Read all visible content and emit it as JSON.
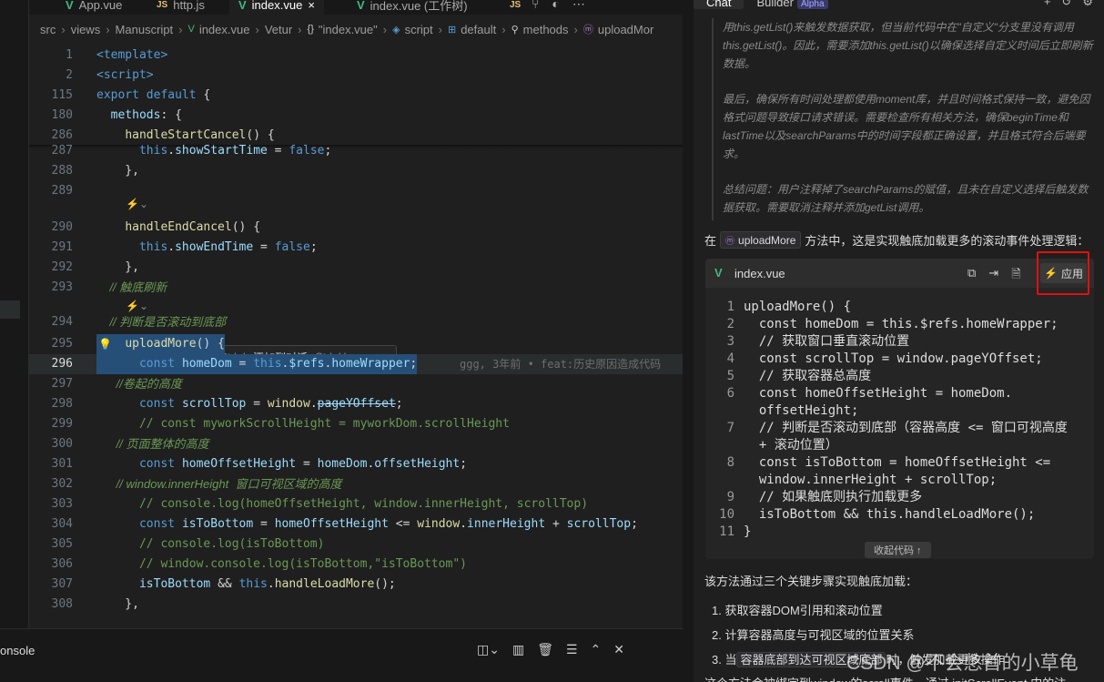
{
  "tabs": [
    {
      "name": "App.vue",
      "kind": "vue"
    },
    {
      "name": "http.js",
      "kind": "js"
    },
    {
      "name": "index.vue",
      "kind": "vue",
      "active": true
    },
    {
      "name": "index.vue (工作树)",
      "kind": "vue"
    }
  ],
  "tab_close": "×",
  "tab_extra": {
    "js_badge": "JS"
  },
  "breadcrumb": [
    "src",
    "views",
    "Manuscript",
    "index.vue",
    "Vetur",
    "\"index.vue\"",
    "script",
    "default",
    "methods",
    "uploadMor"
  ],
  "editor": {
    "lines": [
      {
        "n": "1",
        "html": [
          [
            "tag",
            "<template>"
          ]
        ]
      },
      {
        "n": "2",
        "html": [
          [
            "tag",
            "<script>"
          ]
        ]
      },
      {
        "n": "115",
        "html": [
          [
            "kw",
            "export default "
          ],
          [
            "",
            "{"
          ]
        ]
      },
      {
        "n": "180",
        "html": [
          [
            "",
            "  "
          ],
          [
            "prop",
            "methods"
          ],
          [
            "",
            ": {"
          ]
        ]
      },
      {
        "n": "286",
        "html": [
          [
            "",
            "    "
          ],
          [
            "fn",
            "handleStartCancel"
          ],
          [
            "",
            "() {"
          ]
        ]
      },
      {
        "n": "287",
        "html": [
          [
            "",
            "      "
          ],
          [
            "this",
            "this"
          ],
          [
            "",
            "."
          ],
          [
            "prop",
            "showStartTime"
          ],
          [
            "",
            " = "
          ],
          [
            "kw",
            "false"
          ],
          [
            "",
            ";"
          ]
        ]
      },
      {
        "n": "288",
        "html": [
          [
            "",
            "    },"
          ]
        ]
      },
      {
        "n": "289",
        "html": [
          [
            "",
            ""
          ]
        ]
      },
      {
        "n": "290",
        "html": [
          [
            "",
            "    "
          ],
          [
            "fn",
            "handleEndCancel"
          ],
          [
            "",
            "() {"
          ]
        ]
      },
      {
        "n": "291",
        "html": [
          [
            "",
            "      "
          ],
          [
            "this",
            "this"
          ],
          [
            "",
            "."
          ],
          [
            "prop",
            "showEndTime"
          ],
          [
            "",
            " = "
          ],
          [
            "kw",
            "false"
          ],
          [
            "",
            ";"
          ]
        ]
      },
      {
        "n": "292",
        "html": [
          [
            "",
            "    },"
          ]
        ]
      },
      {
        "n": "293",
        "html": [
          [
            "cm",
            "    // 触底刷新"
          ]
        ]
      },
      {
        "n": "294",
        "html": [
          [
            "cm",
            "    // 判断是否滚动到底部"
          ]
        ]
      },
      {
        "n": "295",
        "html": [
          [
            "",
            "    "
          ],
          [
            "fn",
            "uploadMore"
          ],
          [
            "",
            "() {"
          ]
        ]
      },
      {
        "n": "296",
        "html": [
          [
            "",
            "      "
          ],
          [
            "kw",
            "const "
          ],
          [
            "prop",
            "homeDom"
          ],
          [
            "",
            " = "
          ],
          [
            "this",
            "this"
          ],
          [
            "",
            "."
          ],
          [
            "prop",
            "$refs"
          ],
          [
            "",
            "."
          ],
          [
            "prop",
            "homeWrapper"
          ],
          [
            "",
            ";"
          ]
        ]
      },
      {
        "n": "297",
        "html": [
          [
            "cm",
            "      //卷起的高度"
          ]
        ]
      },
      {
        "n": "298",
        "html": [
          [
            "",
            "      "
          ],
          [
            "kw",
            "const "
          ],
          [
            "prop",
            "scrollTop"
          ],
          [
            "",
            " = "
          ],
          [
            "fn",
            "window"
          ],
          [
            "",
            "."
          ],
          [
            "prop strike",
            "pageYOffset"
          ],
          [
            "",
            ";"
          ]
        ]
      },
      {
        "n": "299",
        "html": [
          [
            "cm",
            "      // const myworkScrollHeight = myworkDom.scrollHeight"
          ]
        ]
      },
      {
        "n": "300",
        "html": [
          [
            "cm",
            "      // 页面整体的高度"
          ]
        ]
      },
      {
        "n": "301",
        "html": [
          [
            "",
            "      "
          ],
          [
            "kw",
            "const "
          ],
          [
            "prop",
            "homeOffsetHeight"
          ],
          [
            "",
            " = "
          ],
          [
            "prop",
            "homeDom"
          ],
          [
            "",
            "."
          ],
          [
            "prop",
            "offsetHeight"
          ],
          [
            "",
            ";"
          ]
        ]
      },
      {
        "n": "302",
        "html": [
          [
            "cm",
            "      // window.innerHeight  窗口可视区域的高度"
          ]
        ]
      },
      {
        "n": "303",
        "html": [
          [
            "cm",
            "      // console.log(homeOffsetHeight, window.innerHeight, scrollTop)"
          ]
        ]
      },
      {
        "n": "304",
        "html": [
          [
            "",
            "      "
          ],
          [
            "kw",
            "const "
          ],
          [
            "prop",
            "isToBottom"
          ],
          [
            "",
            " = "
          ],
          [
            "prop",
            "homeOffsetHeight"
          ],
          [
            "",
            " <= "
          ],
          [
            "fn",
            "window"
          ],
          [
            "",
            "."
          ],
          [
            "prop",
            "innerHeight"
          ],
          [
            "",
            " + "
          ],
          [
            "prop",
            "scrollTop"
          ],
          [
            "",
            ";"
          ]
        ]
      },
      {
        "n": "305",
        "html": [
          [
            "cm",
            "      // console.log(isToBottom)"
          ]
        ]
      },
      {
        "n": "306",
        "html": [
          [
            "cm",
            "      // window.console.log(isToBottom,\"isToBottom\")"
          ]
        ]
      },
      {
        "n": "307",
        "html": [
          [
            "",
            "      "
          ],
          [
            "prop",
            "isToBottom"
          ],
          [
            "",
            " && "
          ],
          [
            "this",
            "this"
          ],
          [
            "",
            "."
          ],
          [
            "fn",
            "handleLoadMore"
          ],
          [
            "",
            "();"
          ]
        ]
      },
      {
        "n": "308",
        "html": [
          [
            "",
            "    },"
          ]
        ]
      }
    ],
    "blame": "ggg, 3年前 • feat:历史原因造成代码",
    "inline_hint": "⚡⌄"
  },
  "widget": {
    "edit": "编辑",
    "edit_key": "Ctrl+I",
    "add": "添加到对话",
    "add_key": "Ctrl+U"
  },
  "bottom": {
    "label": "onsole"
  },
  "chat": {
    "tab_chat": "Chat",
    "tab_builder": "Builder",
    "alpha": "Alpha",
    "thinking": [
      "用this.getList()来触发数据获取，但当前代码中在\"自定义\"分支里没有调用this.getList()。因此，需要添加this.getList()以确保选择自定义时间后立即刷新数据。",
      "最后，确保所有时间处理都使用moment库，并且时间格式保持一致，避免因格式问题导致接口请求错误。需要检查所有相关方法，确保beginTime和lastTime以及searchParams中的时间字段都正确设置，并且格式符合后端要求。",
      "总结问题：用户注释掉了searchParams的赋值，且未在自定义选择后触发数据获取。需要取消注释并添加getList调用。"
    ],
    "line1_pre": "在",
    "line1_chip": "uploadMore",
    "line1_post": "方法中，这是实现触底加载更多的滚动事件处理逻辑：",
    "card_file": "index.vue",
    "apply": "应用",
    "code": [
      {
        "n": "1",
        "t": "uploadMore() {"
      },
      {
        "n": "2",
        "t": "  const homeDom = this.$refs.homeWrapper;"
      },
      {
        "n": "3",
        "t": "  // 获取窗口垂直滚动位置"
      },
      {
        "n": "4",
        "t": "  const scrollTop = window.pageYOffset;"
      },
      {
        "n": "5",
        "t": "  // 获取容器总高度"
      },
      {
        "n": "6",
        "t": "  const homeOffsetHeight = homeDom.\n  offsetHeight;"
      },
      {
        "n": "7",
        "t": "  // 判断是否滚动到底部（容器高度 <= 窗口可视高度\n  + 滚动位置）"
      },
      {
        "n": "8",
        "t": "  const isToBottom = homeOffsetHeight <=\n  window.innerHeight + scrollTop;"
      },
      {
        "n": "9",
        "t": "  // 如果触底则执行加载更多"
      },
      {
        "n": "10",
        "t": "  isToBottom && this.handleLoadMore();"
      },
      {
        "n": "11",
        "t": "}"
      }
    ],
    "collapse": "收起代码 ↑",
    "summary": "该方法通过三个关键步骤实现触底加载：",
    "steps": [
      "1. 获取容器DOM引用和滚动位置",
      "2. 计算容器高度与可视区域的位置关系"
    ],
    "step3_pre": "3. 当",
    "step3_code": "容器底部到达可视区域底部",
    "step3_post": "时，触发加载更多操作",
    "tail": "这个方法会被绑定到window的scroll事件，通过 initScrollEvent 中的注"
  },
  "watermark": "CSDN @不会憋首的小草龟"
}
